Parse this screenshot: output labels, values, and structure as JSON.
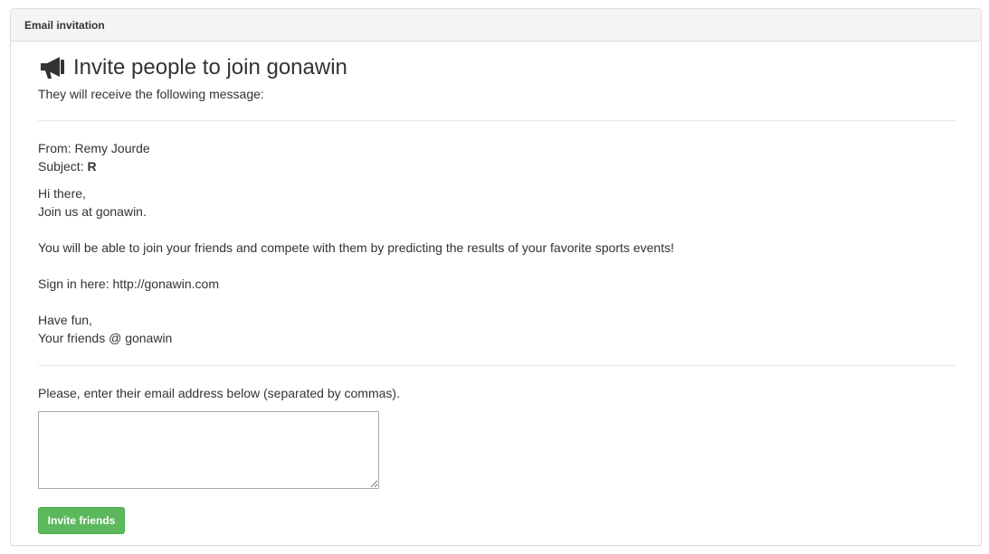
{
  "panel": {
    "heading": "Email invitation"
  },
  "header": {
    "icon": "megaphone-icon",
    "title": "Invite people to join gonawin",
    "subtitle": "They will receive the following message:"
  },
  "message": {
    "from_label": "From:",
    "from_value": "Remy Jourde",
    "subject_label": "Subject:",
    "subject_value": "R",
    "greeting": "Hi there,",
    "line_join": "Join us at gonawin.",
    "line_compete": "You will be able to join your friends and compete with them by predicting the results of your favorite sports events!",
    "line_signin": "Sign in here: http://gonawin.com",
    "closing": "Have fun,",
    "signature": "Your friends @ gonawin"
  },
  "form": {
    "instruction": "Please, enter their email address below (separated by commas).",
    "emails_value": "",
    "submit_label": "Invite friends"
  },
  "colors": {
    "button": "#5cb85c",
    "heading_bg": "#f5f5f5",
    "text": "#333333"
  }
}
